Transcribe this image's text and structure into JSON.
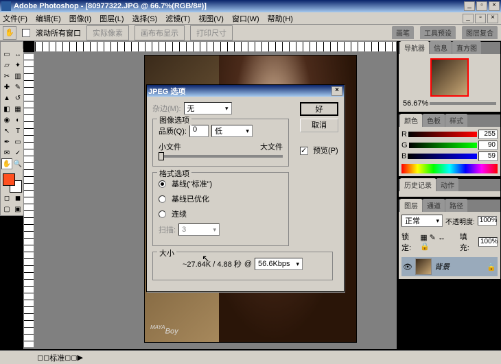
{
  "app": {
    "title": "Adobe Photoshop - [80977322.JPG @ 66.7%(RGB/8#)]"
  },
  "menu": {
    "file": "文件(F)",
    "edit": "编辑(E)",
    "image": "图像(I)",
    "layer": "图层(L)",
    "select": "选择(S)",
    "filter": "滤镜(T)",
    "view": "视图(V)",
    "window": "窗口(W)",
    "help": "帮助(H)"
  },
  "options": {
    "scroll_all": "滚动所有窗口",
    "actual": "实际像素",
    "fit": "画布布显示",
    "print": "打印尺寸"
  },
  "top_tabs": {
    "brush": "画笔",
    "presets": "工具预设",
    "composite": "图层复合"
  },
  "nav": {
    "tab1": "导航器",
    "tab2": "信息",
    "tab3": "直方图",
    "zoom": "56.67%"
  },
  "color": {
    "tab1": "颜色",
    "tab2": "色板",
    "tab3": "样式",
    "r_label": "R",
    "g_label": "G",
    "b_label": "B",
    "r": "255",
    "g": "90",
    "b": "59"
  },
  "history": {
    "tab1": "历史记录",
    "tab2": "动作"
  },
  "layers": {
    "tab1": "图层",
    "tab2": "通道",
    "tab3": "路径",
    "mode": "正常",
    "opacity_label": "不透明度:",
    "opacity": "100%",
    "lock_label": "锁定:",
    "fill_label": "填充:",
    "fill": "100%",
    "bg_layer": "背景"
  },
  "dialog": {
    "title": "JPEG 选项",
    "matte_label": "杂边(M):",
    "matte_value": "无",
    "ok": "好",
    "cancel": "取消",
    "preview": "预览(P)",
    "image_group": "图像选项",
    "quality_label": "品质(Q):",
    "quality_value": "0",
    "quality_preset": "低",
    "small_file": "小文件",
    "large_file": "大文件",
    "format_group": "格式选项",
    "fmt1": "基线(\"标准\")",
    "fmt2": "基线已优化",
    "fmt3": "连续",
    "scans_label": "扫描:",
    "scans_value": "3",
    "size_group": "大小",
    "size_value": "~27.64K / 4.88 秒",
    "size_at": "@",
    "rate": "56.6Kbps"
  },
  "watermark": "Boy",
  "watermark_sup": "MAYA",
  "status": {
    "label": "标准",
    "arrow": "▶"
  }
}
